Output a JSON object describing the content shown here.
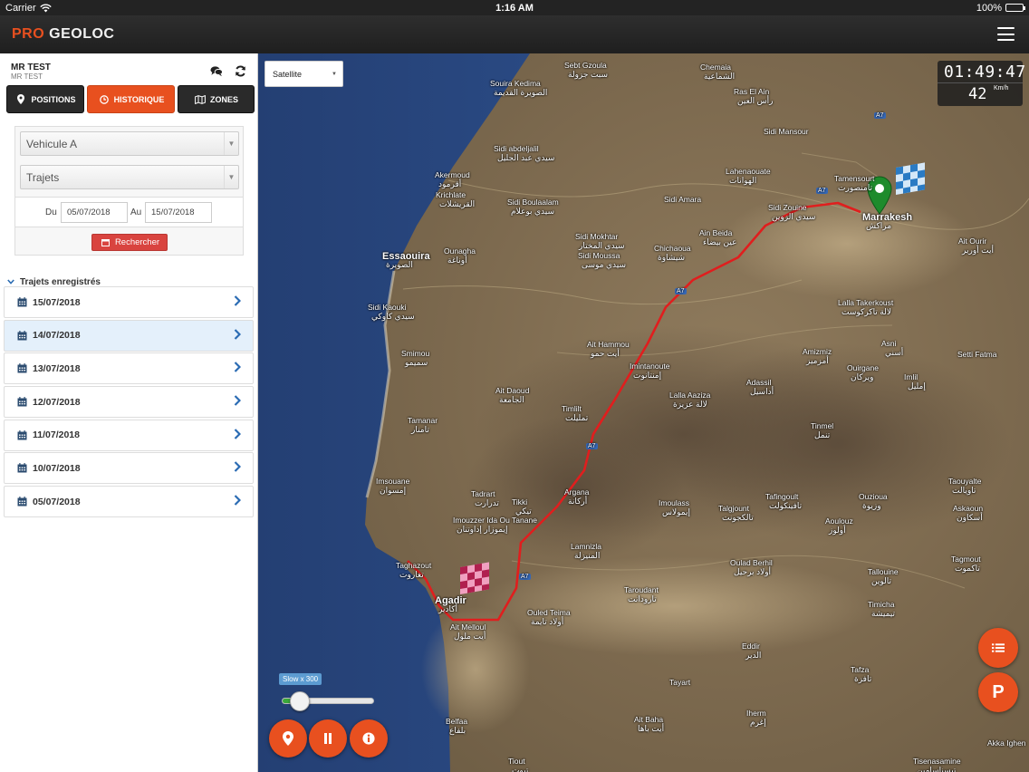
{
  "status_bar": {
    "carrier": "Carrier",
    "time": "1:16 AM",
    "battery": "100%"
  },
  "app": {
    "logo_pro": "PRO",
    "logo_geoloc": "GEOLOC"
  },
  "sidebar": {
    "user_name": "MR TEST",
    "user_sub": "MR TEST",
    "tabs": [
      {
        "label": "POSITIONS",
        "active": false
      },
      {
        "label": "HISTORIQUE",
        "active": true
      },
      {
        "label": "ZONES",
        "active": false
      }
    ],
    "vehicle_select": "Vehicule A",
    "type_select": "Trajets",
    "date_from_label": "Du",
    "date_from": "05/07/2018",
    "date_to_label": "Au",
    "date_to": "15/07/2018",
    "search_label": "Rechercher",
    "trips_heading": "Trajets enregistrés",
    "trips": [
      {
        "date": "15/07/2018",
        "selected": false
      },
      {
        "date": "14/07/2018",
        "selected": true
      },
      {
        "date": "13/07/2018",
        "selected": false
      },
      {
        "date": "12/07/2018",
        "selected": false
      },
      {
        "date": "11/07/2018",
        "selected": false
      },
      {
        "date": "10/07/2018",
        "selected": false
      },
      {
        "date": "05/07/2018",
        "selected": false
      }
    ]
  },
  "map": {
    "layer_select": "Satellite",
    "clock_time": "01:49:47",
    "speed": "42",
    "speed_unit": "Km/h",
    "playback_label": "Slow x 300",
    "playback_level": 0.22,
    "places": [
      {
        "name": "Sebt Gzoula",
        "ar": "سبت جزولة"
      },
      {
        "name": "Chemaia",
        "ar": "الشماعية"
      },
      {
        "name": "Souira Kedima",
        "ar": "الصويرة القديمة"
      },
      {
        "name": "Ras El Ain",
        "ar": "رأس العين"
      },
      {
        "name": "Sidi Mansour",
        "ar": ""
      },
      {
        "name": "Sidi abdeljalil",
        "ar": "سيدي عبد الجليل"
      },
      {
        "name": "Lahenaouate",
        "ar": "الهوانات"
      },
      {
        "name": "Akermoud",
        "ar": "أقرمود"
      },
      {
        "name": "Krichlate",
        "ar": "القريشلات"
      },
      {
        "name": "Sidi Amara",
        "ar": ""
      },
      {
        "name": "Tamensourt",
        "ar": "تامنصورت"
      },
      {
        "name": "Sidi Boulaalam",
        "ar": "سيدي بوعلام"
      },
      {
        "name": "Sidi Zouine",
        "ar": "سيدي الزوين"
      },
      {
        "name": "Marrakesh",
        "ar": "مراكش"
      },
      {
        "name": "Sidi Mokhtar",
        "ar": "سيدي المختار"
      },
      {
        "name": "Ain Beida",
        "ar": "عين بيضاء"
      },
      {
        "name": "Ounagha",
        "ar": "أوناغة"
      },
      {
        "name": "Chichaoua",
        "ar": "شيشاوة"
      },
      {
        "name": "Sidi Moussa",
        "ar": "سيدي موسى"
      },
      {
        "name": "Ait Ourir",
        "ar": "أيت أورير"
      },
      {
        "name": "Essaouira",
        "ar": "الصويرة"
      },
      {
        "name": "Sidi Kaouki",
        "ar": "سيدي كاوكي"
      },
      {
        "name": "Lalla Takerkoust",
        "ar": "لالة تاكركوست"
      },
      {
        "name": "Ait Hammou",
        "ar": "أيت حمو"
      },
      {
        "name": "Asni",
        "ar": "أسني"
      },
      {
        "name": "Smimou",
        "ar": "سميمو"
      },
      {
        "name": "Amizmiz",
        "ar": "أمزميز"
      },
      {
        "name": "Setti Fatma",
        "ar": ""
      },
      {
        "name": "Imintanoute",
        "ar": "إمنتانوت"
      },
      {
        "name": "Ouirgane",
        "ar": "ويركان"
      },
      {
        "name": "Adassil",
        "ar": "أداسيل"
      },
      {
        "name": "Imlil",
        "ar": "إمليل"
      },
      {
        "name": "Ait Daoud",
        "ar": "الجامعة"
      },
      {
        "name": "Lalla Aaziza",
        "ar": "لالة عزيزة"
      },
      {
        "name": "Timlilt",
        "ar": "تمليلت"
      },
      {
        "name": "Tamanar",
        "ar": "تامنار"
      },
      {
        "name": "Tinmel",
        "ar": "تنمل"
      },
      {
        "name": "Imsouane",
        "ar": "إمسوان"
      },
      {
        "name": "Taouyalte",
        "ar": "تاويالت"
      },
      {
        "name": "Tadrart",
        "ar": "تدرارت"
      },
      {
        "name": "Tikki",
        "ar": "تيكي"
      },
      {
        "name": "Argana",
        "ar": "أركانة"
      },
      {
        "name": "Tafingoult",
        "ar": "تافينكولت"
      },
      {
        "name": "Ouzioua",
        "ar": "وزيوة"
      },
      {
        "name": "Imouzzer Ida Ou Tanane",
        "ar": "إيموزار إداوتنان"
      },
      {
        "name": "Imoulass",
        "ar": "إيمولاس"
      },
      {
        "name": "Talgjount",
        "ar": "تالكجونت"
      },
      {
        "name": "Askaoun",
        "ar": "أسكاون"
      },
      {
        "name": "Aoulouz",
        "ar": "أولوز"
      },
      {
        "name": "Lamnizla",
        "ar": "المنيزلة"
      },
      {
        "name": "Oulad Berhil",
        "ar": "أولاد برحيل"
      },
      {
        "name": "Taghazout",
        "ar": "تغازوت"
      },
      {
        "name": "Tagmout",
        "ar": "تاكموت"
      },
      {
        "name": "Taroudant",
        "ar": "تارودانت"
      },
      {
        "name": "Tallouine",
        "ar": "تالوين"
      },
      {
        "name": "Agadir",
        "ar": "أكادير"
      },
      {
        "name": "Ouled Teima",
        "ar": "أولاد تايمة"
      },
      {
        "name": "Timicha",
        "ar": "تيميشة"
      },
      {
        "name": "Ait Melloul",
        "ar": "أيت ملول"
      },
      {
        "name": "Eddir",
        "ar": "الدير"
      },
      {
        "name": "Tafza",
        "ar": "تافزة"
      },
      {
        "name": "Tayart",
        "ar": ""
      },
      {
        "name": "Iherm",
        "ar": "إغرم"
      },
      {
        "name": "Ait Baha",
        "ar": "أيت باها"
      },
      {
        "name": "Belfaa",
        "ar": "بلفاع"
      },
      {
        "name": "Tisenasamine",
        "ar": "تيسناسامين"
      },
      {
        "name": "Tiout",
        "ar": "تيوت"
      },
      {
        "name": "Akka Ighen",
        "ar": ""
      }
    ],
    "road_labels": [
      "A7",
      "A7",
      "A7",
      "A7",
      "A7"
    ]
  },
  "colors": {
    "accent": "#e8501f",
    "route": "#e01e1e",
    "header": "#262626",
    "selected_row": "#e4f0fb",
    "search_button": "#d9443f",
    "start_marker": "#1e8b2c"
  }
}
